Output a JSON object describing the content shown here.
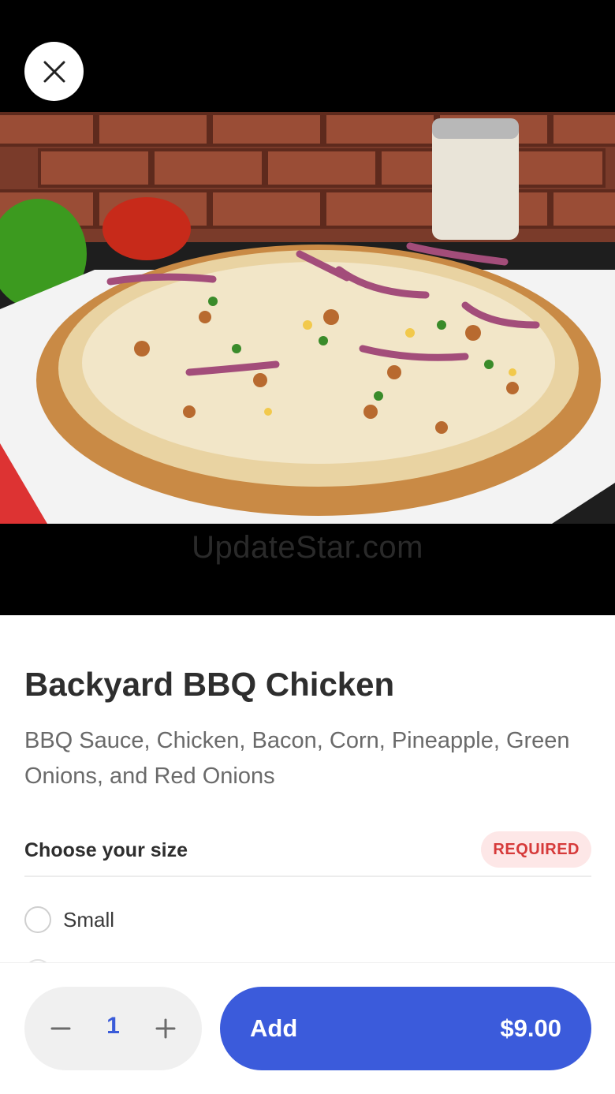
{
  "header": {
    "close_icon": "close-icon",
    "watermark": "UpdateStar.com"
  },
  "item": {
    "title": "Backyard BBQ Chicken",
    "description": "BBQ Sauce, Chicken, Bacon, Corn, Pineapple, Green Onions, and Red Onions",
    "image_alt": "pizza-photo"
  },
  "size_group": {
    "title": "Choose your size",
    "badge": "REQUIRED",
    "options": [
      {
        "label": "Small",
        "selected": false
      }
    ]
  },
  "footer": {
    "quantity": "1",
    "minus_icon": "minus-icon",
    "plus_icon": "plus-icon",
    "add_label": "Add",
    "price": "$9.00"
  },
  "colors": {
    "accent": "#3b5bdb",
    "badge_bg": "#fde7e7",
    "badge_text": "#d63a3a",
    "quantity_text": "#3a5bd9"
  }
}
